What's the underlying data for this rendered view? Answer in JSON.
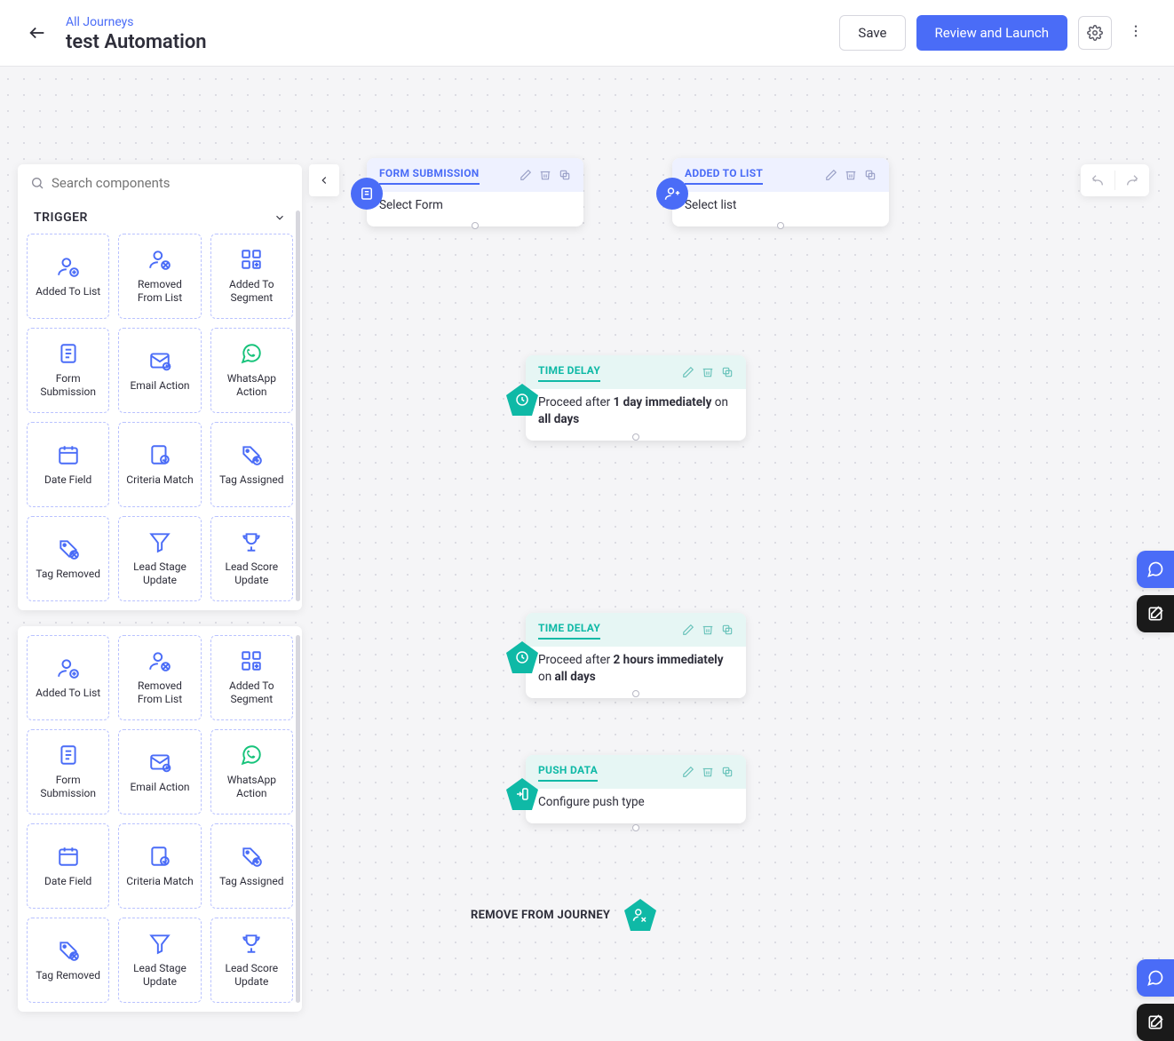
{
  "header": {
    "breadcrumb": "All Journeys",
    "title": "test Automation",
    "save_label": "Save",
    "review_label": "Review and Launch"
  },
  "search": {
    "placeholder": "Search components"
  },
  "section": {
    "title": "TRIGGER"
  },
  "tiles": [
    {
      "label": "Added To List",
      "icon": "user-plus"
    },
    {
      "label": "Removed From List",
      "icon": "user-minus"
    },
    {
      "label": "Added To Segment",
      "icon": "segment"
    },
    {
      "label": "Form Submission",
      "icon": "form"
    },
    {
      "label": "Email Action",
      "icon": "email"
    },
    {
      "label": "WhatsApp Action",
      "icon": "whatsapp",
      "green": true
    },
    {
      "label": "Date Field",
      "icon": "calendar"
    },
    {
      "label": "Criteria Match",
      "icon": "criteria"
    },
    {
      "label": "Tag Assigned",
      "icon": "tag-plus"
    },
    {
      "label": "Tag Removed",
      "icon": "tag-minus"
    },
    {
      "label": "Lead Stage Update",
      "icon": "funnel"
    },
    {
      "label": "Lead Score Update",
      "icon": "trophy"
    }
  ],
  "flow": {
    "node_form": {
      "title": "FORM SUBMISSION",
      "body": "Select Form"
    },
    "node_list": {
      "title": "ADDED TO LIST",
      "body": "Select list"
    },
    "node_delay1": {
      "title": "TIME DELAY",
      "pre": "Proceed after ",
      "val": "1 day immediately",
      "mid": " on ",
      "end": "all days"
    },
    "node_delay2": {
      "title": "TIME DELAY",
      "pre": "Proceed after ",
      "val": "2 hours immediately",
      "mid": " on ",
      "end": "all days"
    },
    "node_push": {
      "title": "PUSH DATA",
      "body": "Configure push type"
    },
    "end": {
      "label": "REMOVE FROM JOURNEY"
    }
  }
}
